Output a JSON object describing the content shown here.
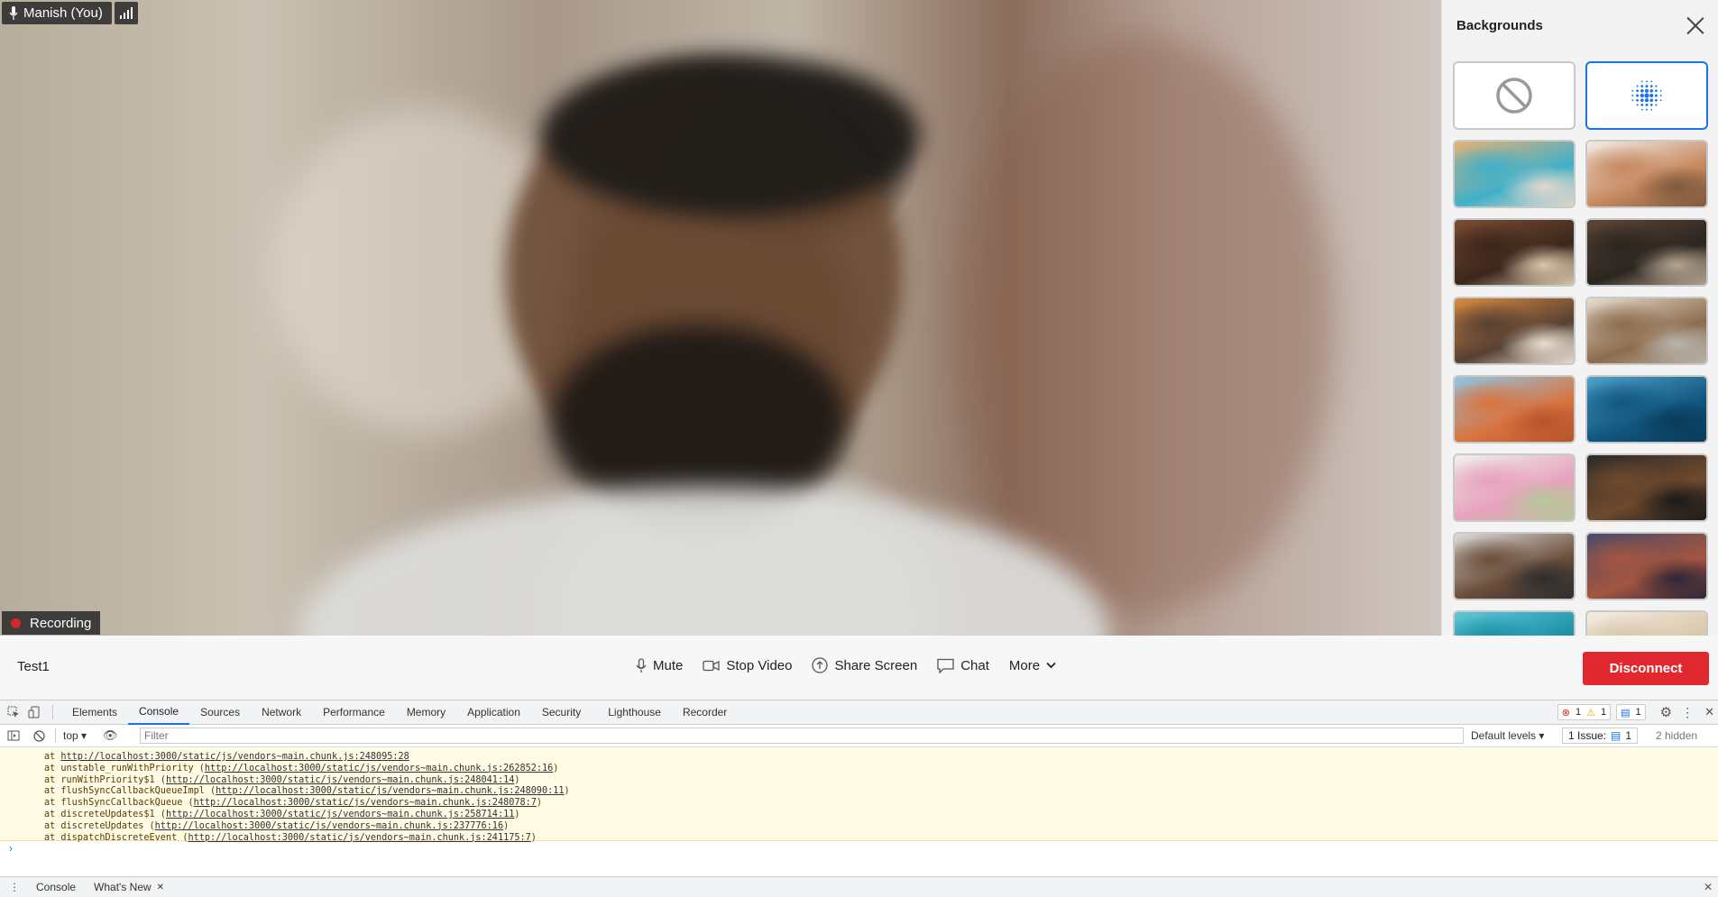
{
  "video": {
    "participant_label": "Manish (You)",
    "recording_label": "Recording"
  },
  "backgrounds_panel": {
    "title": "Backgrounds",
    "tiles": [
      {
        "name": "none",
        "kind": "none-icon",
        "selected": false
      },
      {
        "name": "blur",
        "kind": "blur-icon",
        "selected": true
      },
      {
        "name": "ink-clouds",
        "colors": [
          "#e9b074",
          "#3fb0c9",
          "#e3d8cc"
        ]
      },
      {
        "name": "living-room-plants",
        "colors": [
          "#f2ede6",
          "#c6885f",
          "#7f5a3d"
        ]
      },
      {
        "name": "bookshelf",
        "colors": [
          "#7b4d34",
          "#3b261b",
          "#d8c7aa"
        ]
      },
      {
        "name": "kitchen-cafe",
        "colors": [
          "#5d4636",
          "#2b2520",
          "#b4a38f"
        ]
      },
      {
        "name": "lounge-orange-curtain",
        "colors": [
          "#d98a3f",
          "#564032",
          "#e8ddd0"
        ]
      },
      {
        "name": "cozy-living-room",
        "colors": [
          "#e6dccf",
          "#8d6c4d",
          "#b8b3aa"
        ]
      },
      {
        "name": "desert-dunes",
        "colors": [
          "#8fc5e4",
          "#d9743f",
          "#b8542c"
        ]
      },
      {
        "name": "underwater",
        "colors": [
          "#4da1cb",
          "#11567e",
          "#0a3b5a"
        ]
      },
      {
        "name": "pink-flowers",
        "colors": [
          "#eef1ea",
          "#e7a1bd",
          "#b8c79a"
        ]
      },
      {
        "name": "dark-kitchen",
        "colors": [
          "#2a2a2a",
          "#6f4a2d",
          "#1a1a1a"
        ]
      },
      {
        "name": "modern-living",
        "colors": [
          "#dcdcdc",
          "#6b4e3a",
          "#2e2e2e"
        ]
      },
      {
        "name": "red-rocks",
        "colors": [
          "#4a4b6a",
          "#a4553f",
          "#2e2638"
        ]
      },
      {
        "name": "tropical-beach",
        "colors": [
          "#5fc8d6",
          "#1c8ea6",
          "#eae1c9"
        ]
      },
      {
        "name": "bright-room",
        "colors": [
          "#f4ede2",
          "#d8c6a8",
          "#ffffff"
        ]
      }
    ]
  },
  "control_bar": {
    "meeting_name": "Test1",
    "mute": "Mute",
    "stop_video": "Stop Video",
    "share_screen": "Share Screen",
    "chat": "Chat",
    "more": "More",
    "disconnect": "Disconnect"
  },
  "devtools": {
    "tabs": [
      "Elements",
      "Console",
      "Sources",
      "Network",
      "Performance",
      "Memory",
      "Application",
      "Security",
      "Lighthouse",
      "Recorder"
    ],
    "active_tab": "Console",
    "errors": "1",
    "warnings": "1",
    "info": "1",
    "context": "top",
    "filter_placeholder": "Filter",
    "levels": "Default levels",
    "issues": "1 Issue:",
    "issues_count": "1",
    "hidden": "2 hidden",
    "log_lines": [
      {
        "prefix": "at ",
        "url": "http://localhost:3000/static/js/vendors~main.chunk.js:248095:28",
        "suffix": ""
      },
      {
        "prefix": "at unstable_runWithPriority (",
        "url": "http://localhost:3000/static/js/vendors~main.chunk.js:262852:16",
        "suffix": ")"
      },
      {
        "prefix": "at runWithPriority$1 (",
        "url": "http://localhost:3000/static/js/vendors~main.chunk.js:248041:14",
        "suffix": ")"
      },
      {
        "prefix": "at flushSyncCallbackQueueImpl (",
        "url": "http://localhost:3000/static/js/vendors~main.chunk.js:248090:11",
        "suffix": ")"
      },
      {
        "prefix": "at flushSyncCallbackQueue (",
        "url": "http://localhost:3000/static/js/vendors~main.chunk.js:248078:7",
        "suffix": ")"
      },
      {
        "prefix": "at discreteUpdates$1 (",
        "url": "http://localhost:3000/static/js/vendors~main.chunk.js:258714:11",
        "suffix": ")"
      },
      {
        "prefix": "at discreteUpdates (",
        "url": "http://localhost:3000/static/js/vendors~main.chunk.js:237776:16",
        "suffix": ")"
      },
      {
        "prefix": "at dispatchDiscreteEvent (",
        "url": "http://localhost:3000/static/js/vendors~main.chunk.js:241175:7",
        "suffix": ")"
      }
    ],
    "prompt": "›",
    "drawer_tabs": [
      "Console",
      "What's New"
    ]
  }
}
